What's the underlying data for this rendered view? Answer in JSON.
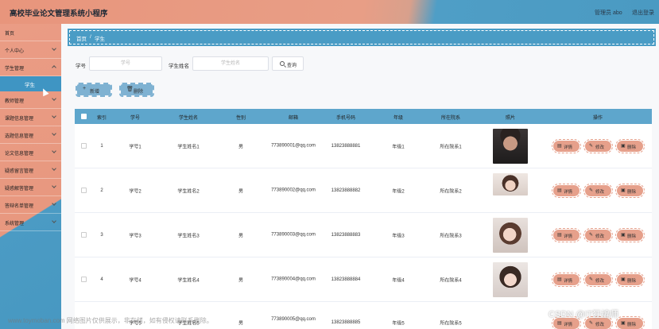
{
  "header": {
    "title": "高校毕业论文管理系统小程序",
    "admin": "管理员 abo",
    "logout": "退出登录"
  },
  "sidebar": {
    "items": [
      {
        "label": "首页",
        "chevron": false
      },
      {
        "label": "个人中心",
        "chevron": true
      },
      {
        "label": "学生管理",
        "chevron": true
      },
      {
        "label": "教师管理",
        "chevron": true
      },
      {
        "label": "课题信息管理",
        "chevron": true
      },
      {
        "label": "选题信息管理",
        "chevron": true
      },
      {
        "label": "论文信息管理",
        "chevron": true
      },
      {
        "label": "疑惑留言管理",
        "chevron": true
      },
      {
        "label": "疑惑解答管理",
        "chevron": true
      },
      {
        "label": "答辩名单管理",
        "chevron": true
      },
      {
        "label": "系统管理",
        "chevron": true
      }
    ],
    "active_sub": "学生"
  },
  "breadcrumb": {
    "home": "首页",
    "sep": "/",
    "current": "学生"
  },
  "search": {
    "field1_label": "学号",
    "field1_placeholder": "学号",
    "field2_label": "学生姓名",
    "field2_placeholder": "学生姓名",
    "button": "查询"
  },
  "actions": {
    "add": "新增",
    "delete": "删除"
  },
  "table": {
    "headers": [
      "索引",
      "学号",
      "学生姓名",
      "性别",
      "邮箱",
      "手机号码",
      "年级",
      "所在院系",
      "照片",
      "操作"
    ],
    "rows": [
      {
        "index": "1",
        "id": "学号1",
        "name": "学生姓名1",
        "gender": "男",
        "email": "773890001@qq.com",
        "phone": "13823888881",
        "grade": "年级1",
        "dept": "所在院系1",
        "photo": "photo-male"
      },
      {
        "index": "2",
        "id": "学号2",
        "name": "学生姓名2",
        "gender": "男",
        "email": "773890002@qq.com",
        "phone": "13823888882",
        "grade": "年级2",
        "dept": "所在院系2",
        "photo": "photo-female"
      },
      {
        "index": "3",
        "id": "学号3",
        "name": "学生姓名3",
        "gender": "男",
        "email": "773890003@qq.com",
        "phone": "13823888883",
        "grade": "年级3",
        "dept": "所在院系3",
        "photo": "photo-female"
      },
      {
        "index": "4",
        "id": "学号4",
        "name": "学生姓名4",
        "gender": "男",
        "email": "773890004@qq.com",
        "phone": "13823888884",
        "grade": "年级4",
        "dept": "所在院系4",
        "photo": "photo-female"
      },
      {
        "index": "5",
        "id": "学号5",
        "name": "学生姓名5",
        "gender": "男",
        "email": "773890005@qq.com",
        "phone": "13823888885",
        "grade": "年级5",
        "dept": "所在院系5",
        "photo": "photo-female"
      }
    ],
    "row_actions": {
      "detail": "详情",
      "edit": "修改",
      "delete": "删除"
    }
  },
  "watermark": {
    "left": "www.toymoban.com 网络图片仅供展示，非存储，如有侵权请联系删除。",
    "right": "CSDN @IT狂编师"
  },
  "colors": {
    "header_left": "#e8957c",
    "header_right": "#4a9ac2",
    "accent": "#4a9cc5",
    "row_button": "#e6a08b",
    "action_button": "#7fb2d2"
  }
}
